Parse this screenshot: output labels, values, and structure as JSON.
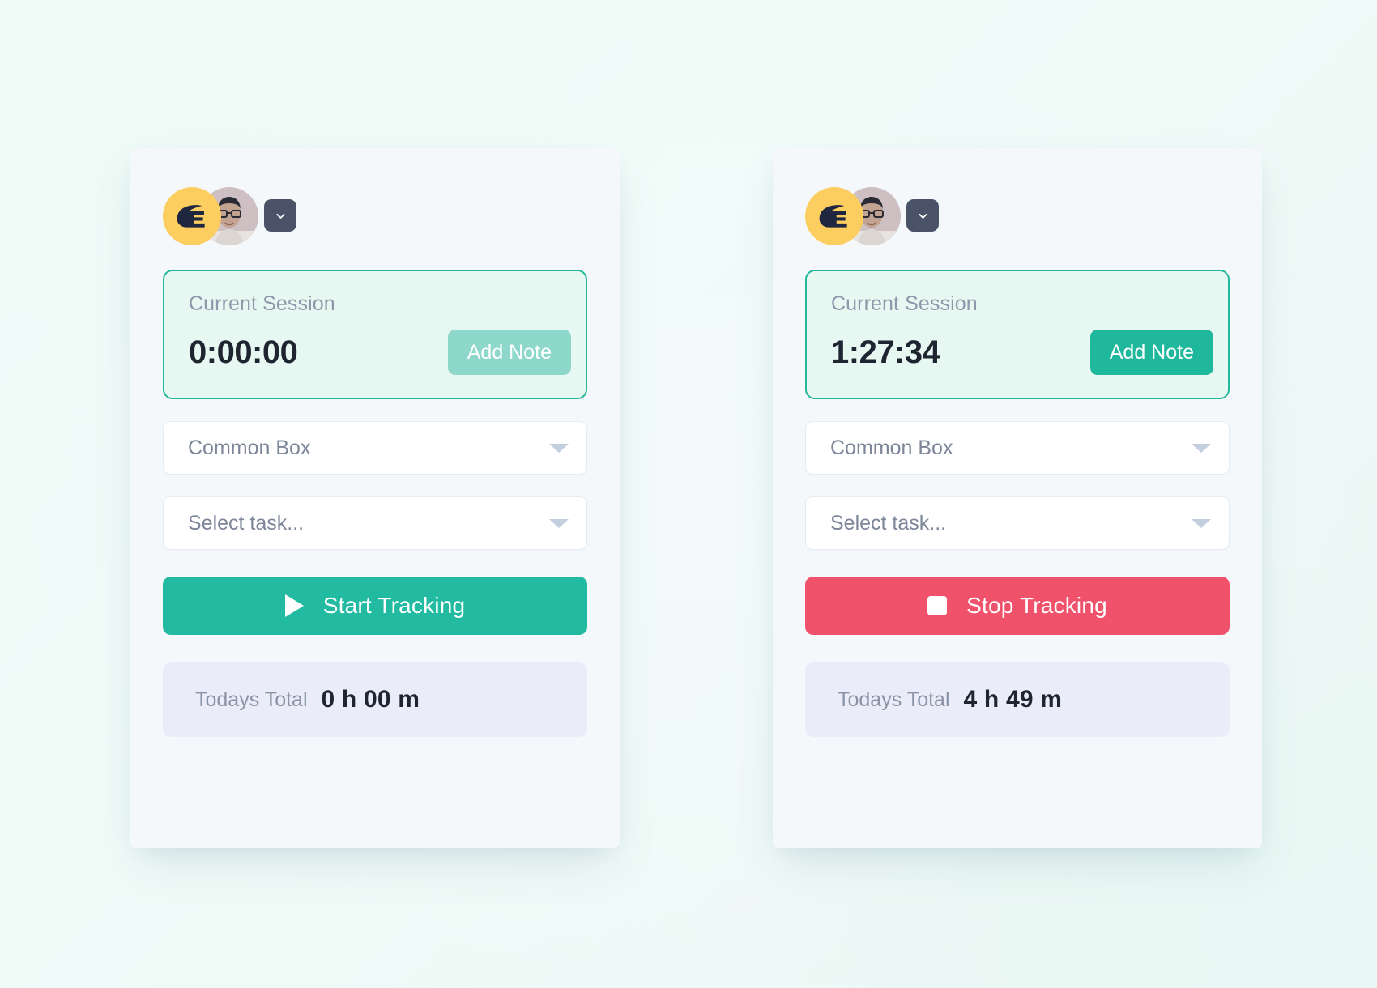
{
  "theme": {
    "page_bg": "#eef9f6",
    "card_bg": "#f5f8fb",
    "accent_teal": "#22bba1",
    "accent_teal_pale": "#8ed8cb",
    "session_panel_bg": "#e7f7f2",
    "session_border": "#24b79a",
    "stop_red": "#f0526c",
    "total_bg": "#eaedf9",
    "logo_yellow": "#fccd5f",
    "chevron_button_bg": "#4a5268",
    "muted_text": "#8a93a6",
    "dark_text": "#1e2430",
    "caret_color": "#c3cede"
  },
  "icons": {
    "logo": "company-logo-e-icon",
    "avatar": "user-avatar-photo",
    "chevron_down": "chevron-down-icon",
    "select_caret": "caret-down-icon",
    "play": "play-icon",
    "stop": "stop-square-icon"
  },
  "cards": [
    {
      "id": "idle-timer-card",
      "state": "idle",
      "header": {
        "chevron_label": "Expand account menu"
      },
      "session": {
        "label": "Current Session",
        "time": "0:00:00",
        "add_note_label": "Add Note",
        "add_note_style": "pale"
      },
      "project_select": {
        "value": "Common Box"
      },
      "task_select": {
        "value": "Select task..."
      },
      "track_button": {
        "label": "Start Tracking",
        "style": "start",
        "icon": "play"
      },
      "total": {
        "label": "Todays Total",
        "value": "0 h 00 m"
      }
    },
    {
      "id": "running-timer-card",
      "state": "running",
      "header": {
        "chevron_label": "Expand account menu"
      },
      "session": {
        "label": "Current Session",
        "time": "1:27:34",
        "add_note_label": "Add Note",
        "add_note_style": "strong"
      },
      "project_select": {
        "value": "Common Box"
      },
      "task_select": {
        "value": "Select task..."
      },
      "track_button": {
        "label": "Stop Tracking",
        "style": "stop",
        "icon": "stop"
      },
      "total": {
        "label": "Todays Total",
        "value": "4 h 49 m"
      }
    }
  ]
}
